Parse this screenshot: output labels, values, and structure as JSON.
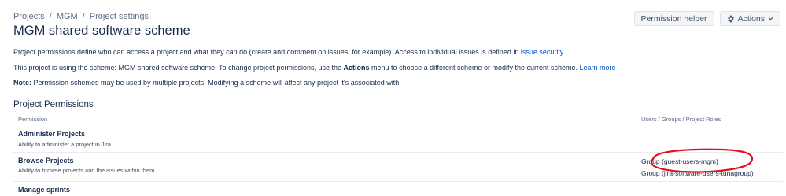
{
  "breadcrumb": {
    "items": [
      "Projects",
      "MGM",
      "Project settings"
    ],
    "separator": "/"
  },
  "page": {
    "title": "MGM shared software scheme"
  },
  "toolbar": {
    "permission_helper_label": "Permission helper",
    "actions_label": "Actions",
    "actions_icon": "gear-icon",
    "actions_chevron": "chevron-down-icon"
  },
  "intro": {
    "line1_text": "Project permissions define who can access a project and what they can do (create and comment on issues, for example). Access to individual issues is defined in ",
    "line1_link": "issue security",
    "line1_end": ".",
    "line2_prefix": "This project is using the scheme: MGM shared software scheme. To change project permissions, use the ",
    "line2_bold": "Actions",
    "line2_suffix": " menu to choose a different scheme or modify the current scheme. ",
    "line2_link": "Learn more",
    "note_label": "Note:",
    "note_text": " Permission schemes may be used by multiple projects. Modifying a scheme will affect any project it's associated with."
  },
  "permissions": {
    "section_title": "Project Permissions",
    "columns": {
      "permission": "Permission",
      "roles": "Users / Groups / Project Roles"
    },
    "rows": [
      {
        "name": "Administer Projects",
        "description": "Ability to administer a project in Jira.",
        "grantees": []
      },
      {
        "name": "Browse Projects",
        "description": "Ability to browse projects and the issues within them.",
        "grantees": [
          "Group (guest-users-mgm)",
          "Group (jira-software-users-tunagroup)"
        ]
      },
      {
        "name": "Manage sprints",
        "description": "",
        "grantees": []
      }
    ]
  },
  "colors": {
    "link": "#0052cc",
    "text": "#172b4d",
    "muted": "#5e6c84",
    "button_bg": "#f4f5f7",
    "annotation": "#e3101a"
  }
}
